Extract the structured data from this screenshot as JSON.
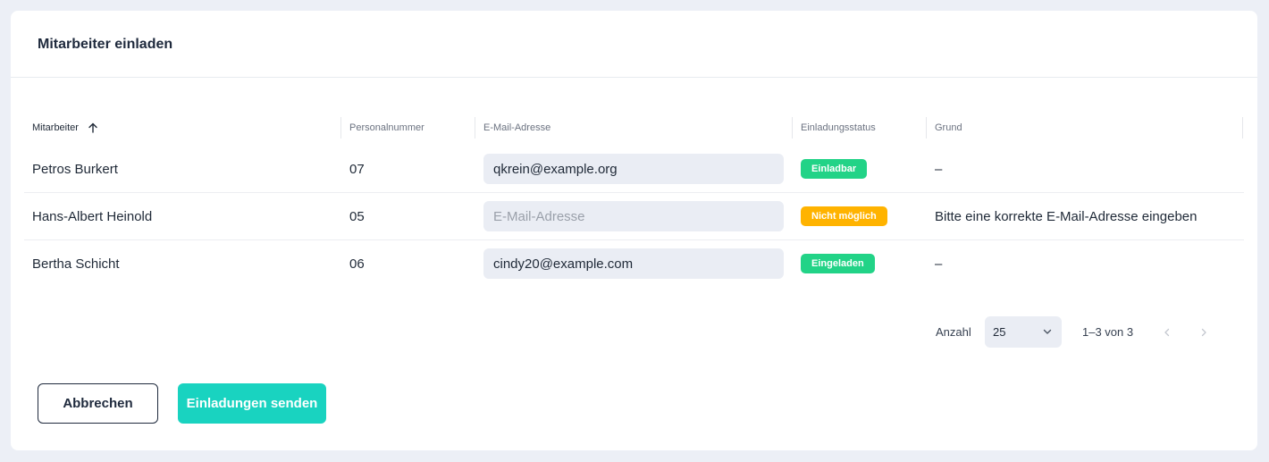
{
  "dialog": {
    "title": "Mitarbeiter einladen"
  },
  "table": {
    "columns": [
      "Mitarbeiter",
      "Personalnummer",
      "E-Mail-Adresse",
      "Einladungsstatus",
      "Grund"
    ],
    "sort": {
      "column": "Mitarbeiter",
      "direction": "ascending",
      "icon": "arrow-up-icon"
    },
    "rows": [
      {
        "name": "Petros Burkert",
        "personalnummer": "07",
        "email": "qkrein@example.org",
        "email_placeholder": "E-Mail-Adresse",
        "status": "Einladbar",
        "status_color": "#22d387",
        "grund": "–"
      },
      {
        "name": "Hans-Albert Heinold",
        "personalnummer": "05",
        "email": "",
        "email_placeholder": "E-Mail-Adresse",
        "status": "Nicht möglich",
        "status_color": "#ffb300",
        "grund": "Bitte eine korrekte E-Mail-Adresse eingeben"
      },
      {
        "name": "Bertha Schicht",
        "personalnummer": "06",
        "email": "cindy20@example.com",
        "email_placeholder": "E-Mail-Adresse",
        "status": "Eingeladen",
        "status_color": "#22d387",
        "grund": "–"
      }
    ]
  },
  "pagination": {
    "label": "Anzahl",
    "page_size": "25",
    "range": "1–3 von 3",
    "prev_icon": "chevron-left-icon",
    "next_icon": "chevron-right-icon"
  },
  "actions": {
    "cancel_label": "Abbrechen",
    "send_label": "Einladungen senden"
  },
  "colors": {
    "accent": "#19d3c0",
    "background": "#eceff6",
    "success": "#22d387",
    "warning": "#ffb300"
  }
}
